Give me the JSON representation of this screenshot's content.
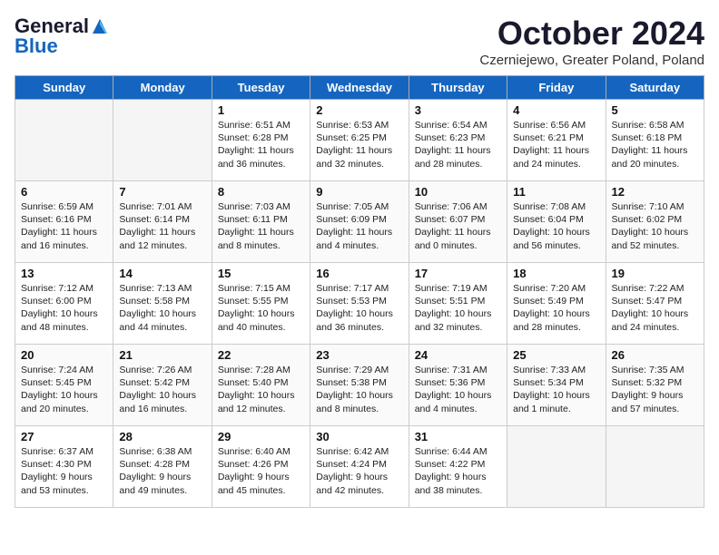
{
  "header": {
    "logo_line1": "General",
    "logo_line2": "Blue",
    "month": "October 2024",
    "location": "Czerniejewo, Greater Poland, Poland"
  },
  "days_of_week": [
    "Sunday",
    "Monday",
    "Tuesday",
    "Wednesday",
    "Thursday",
    "Friday",
    "Saturday"
  ],
  "weeks": [
    [
      {
        "day": "",
        "text": ""
      },
      {
        "day": "",
        "text": ""
      },
      {
        "day": "1",
        "text": "Sunrise: 6:51 AM\nSunset: 6:28 PM\nDaylight: 11 hours\nand 36 minutes."
      },
      {
        "day": "2",
        "text": "Sunrise: 6:53 AM\nSunset: 6:25 PM\nDaylight: 11 hours\nand 32 minutes."
      },
      {
        "day": "3",
        "text": "Sunrise: 6:54 AM\nSunset: 6:23 PM\nDaylight: 11 hours\nand 28 minutes."
      },
      {
        "day": "4",
        "text": "Sunrise: 6:56 AM\nSunset: 6:21 PM\nDaylight: 11 hours\nand 24 minutes."
      },
      {
        "day": "5",
        "text": "Sunrise: 6:58 AM\nSunset: 6:18 PM\nDaylight: 11 hours\nand 20 minutes."
      }
    ],
    [
      {
        "day": "6",
        "text": "Sunrise: 6:59 AM\nSunset: 6:16 PM\nDaylight: 11 hours\nand 16 minutes."
      },
      {
        "day": "7",
        "text": "Sunrise: 7:01 AM\nSunset: 6:14 PM\nDaylight: 11 hours\nand 12 minutes."
      },
      {
        "day": "8",
        "text": "Sunrise: 7:03 AM\nSunset: 6:11 PM\nDaylight: 11 hours\nand 8 minutes."
      },
      {
        "day": "9",
        "text": "Sunrise: 7:05 AM\nSunset: 6:09 PM\nDaylight: 11 hours\nand 4 minutes."
      },
      {
        "day": "10",
        "text": "Sunrise: 7:06 AM\nSunset: 6:07 PM\nDaylight: 11 hours\nand 0 minutes."
      },
      {
        "day": "11",
        "text": "Sunrise: 7:08 AM\nSunset: 6:04 PM\nDaylight: 10 hours\nand 56 minutes."
      },
      {
        "day": "12",
        "text": "Sunrise: 7:10 AM\nSunset: 6:02 PM\nDaylight: 10 hours\nand 52 minutes."
      }
    ],
    [
      {
        "day": "13",
        "text": "Sunrise: 7:12 AM\nSunset: 6:00 PM\nDaylight: 10 hours\nand 48 minutes."
      },
      {
        "day": "14",
        "text": "Sunrise: 7:13 AM\nSunset: 5:58 PM\nDaylight: 10 hours\nand 44 minutes."
      },
      {
        "day": "15",
        "text": "Sunrise: 7:15 AM\nSunset: 5:55 PM\nDaylight: 10 hours\nand 40 minutes."
      },
      {
        "day": "16",
        "text": "Sunrise: 7:17 AM\nSunset: 5:53 PM\nDaylight: 10 hours\nand 36 minutes."
      },
      {
        "day": "17",
        "text": "Sunrise: 7:19 AM\nSunset: 5:51 PM\nDaylight: 10 hours\nand 32 minutes."
      },
      {
        "day": "18",
        "text": "Sunrise: 7:20 AM\nSunset: 5:49 PM\nDaylight: 10 hours\nand 28 minutes."
      },
      {
        "day": "19",
        "text": "Sunrise: 7:22 AM\nSunset: 5:47 PM\nDaylight: 10 hours\nand 24 minutes."
      }
    ],
    [
      {
        "day": "20",
        "text": "Sunrise: 7:24 AM\nSunset: 5:45 PM\nDaylight: 10 hours\nand 20 minutes."
      },
      {
        "day": "21",
        "text": "Sunrise: 7:26 AM\nSunset: 5:42 PM\nDaylight: 10 hours\nand 16 minutes."
      },
      {
        "day": "22",
        "text": "Sunrise: 7:28 AM\nSunset: 5:40 PM\nDaylight: 10 hours\nand 12 minutes."
      },
      {
        "day": "23",
        "text": "Sunrise: 7:29 AM\nSunset: 5:38 PM\nDaylight: 10 hours\nand 8 minutes."
      },
      {
        "day": "24",
        "text": "Sunrise: 7:31 AM\nSunset: 5:36 PM\nDaylight: 10 hours\nand 4 minutes."
      },
      {
        "day": "25",
        "text": "Sunrise: 7:33 AM\nSunset: 5:34 PM\nDaylight: 10 hours\nand 1 minute."
      },
      {
        "day": "26",
        "text": "Sunrise: 7:35 AM\nSunset: 5:32 PM\nDaylight: 9 hours\nand 57 minutes."
      }
    ],
    [
      {
        "day": "27",
        "text": "Sunrise: 6:37 AM\nSunset: 4:30 PM\nDaylight: 9 hours\nand 53 minutes."
      },
      {
        "day": "28",
        "text": "Sunrise: 6:38 AM\nSunset: 4:28 PM\nDaylight: 9 hours\nand 49 minutes."
      },
      {
        "day": "29",
        "text": "Sunrise: 6:40 AM\nSunset: 4:26 PM\nDaylight: 9 hours\nand 45 minutes."
      },
      {
        "day": "30",
        "text": "Sunrise: 6:42 AM\nSunset: 4:24 PM\nDaylight: 9 hours\nand 42 minutes."
      },
      {
        "day": "31",
        "text": "Sunrise: 6:44 AM\nSunset: 4:22 PM\nDaylight: 9 hours\nand 38 minutes."
      },
      {
        "day": "",
        "text": ""
      },
      {
        "day": "",
        "text": ""
      }
    ]
  ]
}
